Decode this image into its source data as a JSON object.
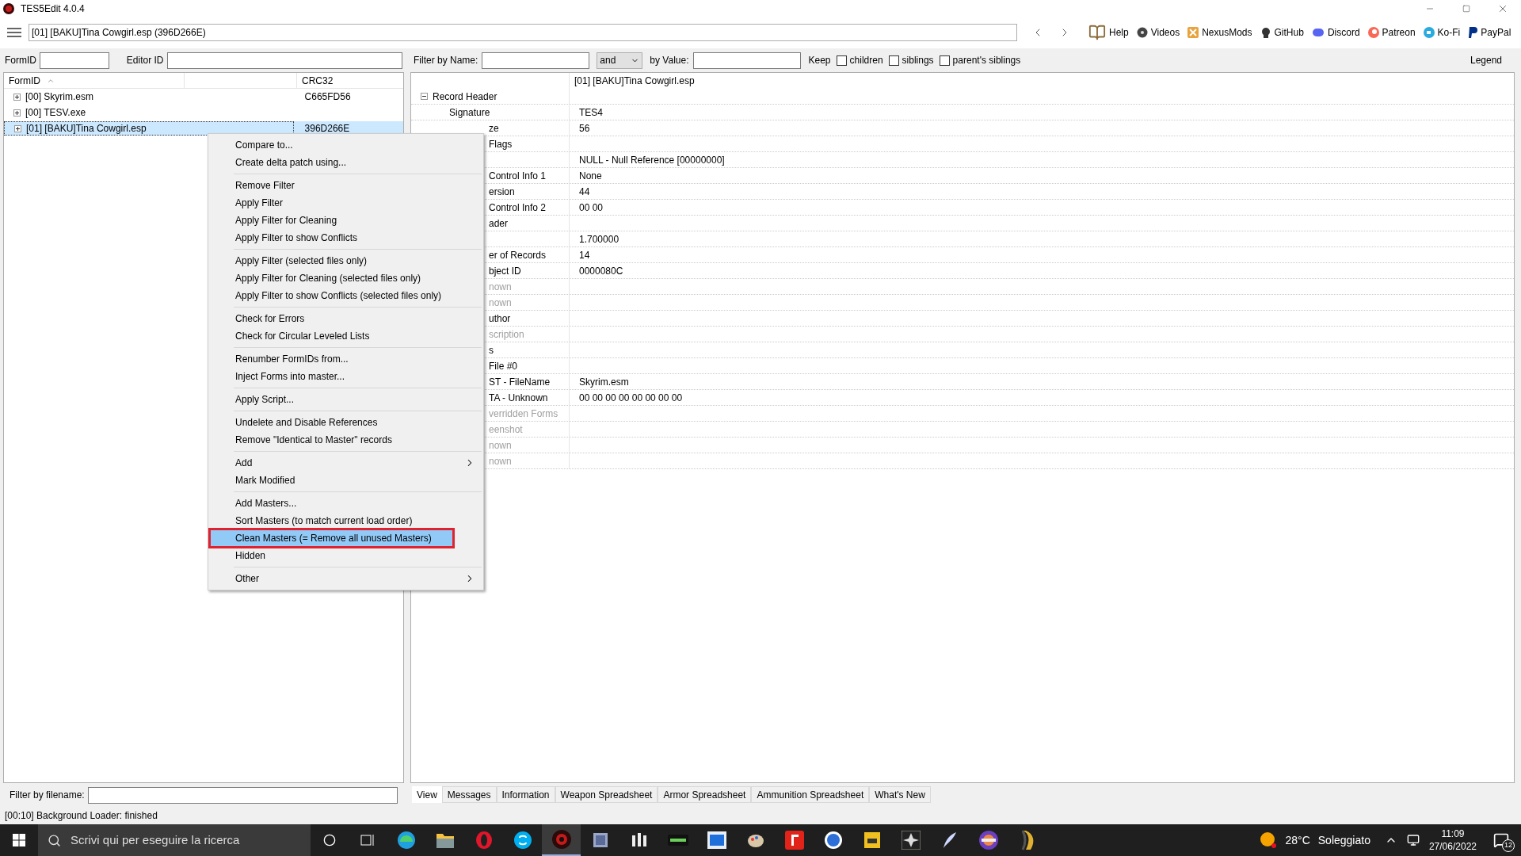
{
  "window": {
    "title": "TES5Edit 4.0.4"
  },
  "toolbar": {
    "path": "[01] [BAKU]Tina Cowgirl.esp (396D266E)",
    "links": [
      {
        "label": "Help",
        "kind": "book"
      },
      {
        "label": "Videos",
        "kind": "film"
      },
      {
        "label": "NexusMods",
        "kind": "nexus"
      },
      {
        "label": "GitHub",
        "kind": "github"
      },
      {
        "label": "Discord",
        "kind": "discord"
      },
      {
        "label": "Patreon",
        "kind": "patreon"
      },
      {
        "label": "Ko-Fi",
        "kind": "kofi"
      },
      {
        "label": "PayPal",
        "kind": "paypal"
      }
    ]
  },
  "left_panel": {
    "formid_label": "FormID",
    "editorid_label": "Editor ID",
    "columns": [
      "FormID",
      "CRC32"
    ],
    "rows": [
      {
        "name": "[00] Skyrim.esm",
        "crc": "C665FD56",
        "selected": false
      },
      {
        "name": "[00] TESV.exe",
        "crc": "",
        "selected": false
      },
      {
        "name": "[01] [BAKU]Tina Cowgirl.esp",
        "crc": "396D266E",
        "selected": true
      }
    ],
    "filter_label": "Filter by filename:"
  },
  "filter_bar": {
    "name_label": "Filter by Name:",
    "operator": "and",
    "value_label": "by Value:",
    "keep_label": "Keep",
    "options": [
      {
        "label": "children",
        "checked": false
      },
      {
        "label": "siblings",
        "checked": false
      },
      {
        "label": "parent's siblings",
        "checked": false
      }
    ],
    "legend": "Legend"
  },
  "record_view": {
    "header": "[01] [BAKU]Tina Cowgirl.esp",
    "group": "Record Header",
    "rows": [
      {
        "label": "Signature",
        "value": "TES4",
        "greyed": false
      },
      {
        "label": "ze",
        "value": "56",
        "greyed": false
      },
      {
        "label": "Flags",
        "value": "",
        "greyed": false
      },
      {
        "label": "",
        "value": "NULL - Null Reference [00000000]",
        "greyed": false
      },
      {
        "label": "Control Info 1",
        "value": "None",
        "greyed": false
      },
      {
        "label": "ersion",
        "value": "44",
        "greyed": false
      },
      {
        "label": "Control Info 2",
        "value": "00 00",
        "greyed": false
      },
      {
        "label": "ader",
        "value": "",
        "greyed": false
      },
      {
        "label": "",
        "value": "1.700000",
        "greyed": false
      },
      {
        "label": "er of Records",
        "value": "14",
        "greyed": false
      },
      {
        "label": "bject ID",
        "value": "0000080C",
        "greyed": false
      },
      {
        "label": "nown",
        "value": "",
        "greyed": true
      },
      {
        "label": "nown",
        "value": "",
        "greyed": true
      },
      {
        "label": "uthor",
        "value": "",
        "greyed": false
      },
      {
        "label": "scription",
        "value": "",
        "greyed": true
      },
      {
        "label": "s",
        "value": "",
        "greyed": false
      },
      {
        "label": "File #0",
        "value": "",
        "greyed": false
      },
      {
        "label": "ST - FileName",
        "value": "Skyrim.esm",
        "greyed": false
      },
      {
        "label": "TA - Unknown",
        "value": "00 00 00 00 00 00 00 00",
        "greyed": false
      },
      {
        "label": "verridden Forms",
        "value": "",
        "greyed": true
      },
      {
        "label": "eenshot",
        "value": "",
        "greyed": true
      },
      {
        "label": "nown",
        "value": "",
        "greyed": true
      },
      {
        "label": "nown",
        "value": "",
        "greyed": true
      }
    ]
  },
  "context_menu": [
    {
      "kind": "item",
      "label": "Compare to...",
      "selected": false,
      "marked": false
    },
    {
      "kind": "item",
      "label": "Create delta patch using...",
      "selected": false,
      "marked": false
    },
    {
      "kind": "separator"
    },
    {
      "kind": "item",
      "label": "Remove Filter",
      "selected": false,
      "marked": false
    },
    {
      "kind": "item",
      "label": "Apply Filter",
      "selected": false,
      "marked": false
    },
    {
      "kind": "item",
      "label": "Apply Filter for Cleaning",
      "selected": false,
      "marked": false
    },
    {
      "kind": "item",
      "label": "Apply Filter to show Conflicts",
      "selected": false,
      "marked": false
    },
    {
      "kind": "separator"
    },
    {
      "kind": "item",
      "label": "Apply Filter (selected files only)",
      "selected": false,
      "marked": false
    },
    {
      "kind": "item",
      "label": "Apply Filter for Cleaning (selected files only)",
      "selected": false,
      "marked": false
    },
    {
      "kind": "item",
      "label": "Apply Filter to show Conflicts (selected files only)",
      "selected": false,
      "marked": false
    },
    {
      "kind": "separator"
    },
    {
      "kind": "item",
      "label": "Check for Errors",
      "selected": false,
      "marked": false
    },
    {
      "kind": "item",
      "label": "Check for Circular Leveled Lists",
      "selected": false,
      "marked": false
    },
    {
      "kind": "separator"
    },
    {
      "kind": "item",
      "label": "Renumber FormIDs from...",
      "selected": false,
      "marked": false
    },
    {
      "kind": "item",
      "label": "Inject Forms into master...",
      "selected": false,
      "marked": false
    },
    {
      "kind": "separator"
    },
    {
      "kind": "item",
      "label": "Apply Script...",
      "selected": false,
      "marked": false
    },
    {
      "kind": "separator"
    },
    {
      "kind": "item",
      "label": "Undelete and Disable References",
      "selected": false,
      "marked": false
    },
    {
      "kind": "item",
      "label": "Remove \"Identical to Master\" records",
      "selected": false,
      "marked": false
    },
    {
      "kind": "separator"
    },
    {
      "kind": "submenu",
      "label": "Add",
      "selected": false,
      "marked": false
    },
    {
      "kind": "item",
      "label": "Mark Modified",
      "selected": false,
      "marked": false
    },
    {
      "kind": "separator"
    },
    {
      "kind": "item",
      "label": "Add Masters...",
      "selected": false,
      "marked": false
    },
    {
      "kind": "item",
      "label": "Sort Masters (to match current load order)",
      "selected": false,
      "marked": false
    },
    {
      "kind": "item",
      "label": "Clean Masters (= Remove all unused Masters)",
      "selected": true,
      "marked": true
    },
    {
      "kind": "item",
      "label": "Hidden",
      "selected": false,
      "marked": false
    },
    {
      "kind": "separator"
    },
    {
      "kind": "submenu",
      "label": "Other",
      "selected": false,
      "marked": false
    }
  ],
  "tabs": [
    {
      "label": "View",
      "selected": true
    },
    {
      "label": "Messages",
      "selected": false
    },
    {
      "label": "Information",
      "selected": false
    },
    {
      "label": "Weapon Spreadsheet",
      "selected": false
    },
    {
      "label": "Armor Spreadsheet",
      "selected": false
    },
    {
      "label": "Ammunition Spreadsheet",
      "selected": false
    },
    {
      "label": "What's New",
      "selected": false
    }
  ],
  "status_bar": "[00:10] Background Loader: finished",
  "taskbar": {
    "search_placeholder": "Scrivi qui per eseguire la ricerca",
    "apps": [
      {
        "kind": "edge",
        "selected": false
      },
      {
        "kind": "folder",
        "selected": false
      },
      {
        "kind": "opera",
        "selected": false
      },
      {
        "kind": "skype",
        "selected": false
      },
      {
        "kind": "xedit",
        "selected": true
      },
      {
        "kind": "box",
        "selected": false
      },
      {
        "kind": "grid",
        "selected": false
      },
      {
        "kind": "nmm",
        "selected": false
      },
      {
        "kind": "window",
        "selected": false
      },
      {
        "kind": "palette",
        "selected": false
      },
      {
        "kind": "f",
        "selected": false
      },
      {
        "kind": "ff",
        "selected": false
      },
      {
        "kind": "note",
        "selected": false
      },
      {
        "kind": "star",
        "selected": false
      },
      {
        "kind": "feather",
        "selected": false
      },
      {
        "kind": "globe",
        "selected": false
      },
      {
        "kind": "moon",
        "selected": false
      }
    ],
    "temperature": "28°C",
    "weather": "Soleggiato",
    "time": "11:09",
    "date": "27/06/2022",
    "notifications": "12"
  }
}
